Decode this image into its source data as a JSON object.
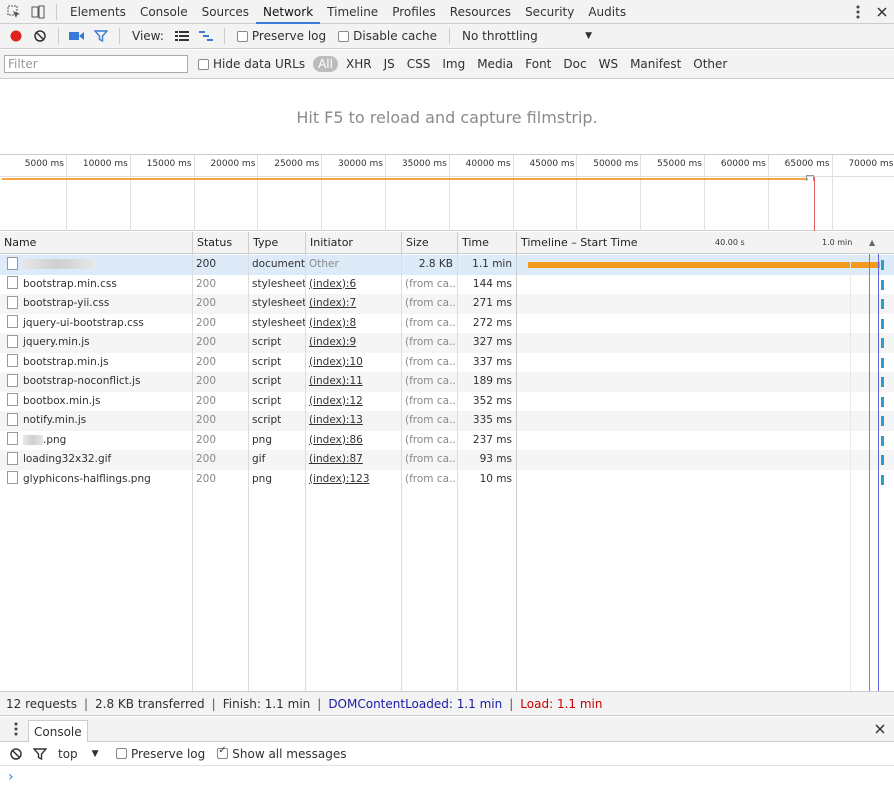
{
  "tabs": [
    "Elements",
    "Console",
    "Sources",
    "Network",
    "Timeline",
    "Profiles",
    "Resources",
    "Security",
    "Audits"
  ],
  "active_tab": "Network",
  "toolbar": {
    "view_label": "View:",
    "preserve_log": "Preserve log",
    "disable_cache": "Disable cache",
    "throttling": "No throttling"
  },
  "filterbar": {
    "placeholder": "Filter",
    "hide_data_urls": "Hide data URLs",
    "types": [
      "All",
      "XHR",
      "JS",
      "CSS",
      "Img",
      "Media",
      "Font",
      "Doc",
      "WS",
      "Manifest",
      "Other"
    ]
  },
  "filmstrip_message": "Hit F5 to reload and capture filmstrip.",
  "overview_ticks": [
    "5000 ms",
    "10000 ms",
    "15000 ms",
    "20000 ms",
    "25000 ms",
    "30000 ms",
    "35000 ms",
    "40000 ms",
    "45000 ms",
    "50000 ms",
    "55000 ms",
    "60000 ms",
    "65000 ms",
    "70000 ms"
  ],
  "columns": {
    "name": "Name",
    "status": "Status",
    "type": "Type",
    "initiator": "Initiator",
    "size": "Size",
    "time": "Time",
    "timeline": "Timeline – Start Time",
    "tick1": "40.00 s",
    "tick2": "1.0 min"
  },
  "rows": [
    {
      "name": "",
      "status": "200",
      "type": "document",
      "initiator": "Other",
      "size": "2.8 KB",
      "time": "1.1 min"
    },
    {
      "name": "bootstrap.min.css",
      "status": "200",
      "type": "stylesheet",
      "initiator": "(index):6",
      "size": "(from ca...",
      "time": "144 ms"
    },
    {
      "name": "bootstrap-yii.css",
      "status": "200",
      "type": "stylesheet",
      "initiator": "(index):7",
      "size": "(from ca...",
      "time": "271 ms"
    },
    {
      "name": "jquery-ui-bootstrap.css",
      "status": "200",
      "type": "stylesheet",
      "initiator": "(index):8",
      "size": "(from ca...",
      "time": "272 ms"
    },
    {
      "name": "jquery.min.js",
      "status": "200",
      "type": "script",
      "initiator": "(index):9",
      "size": "(from ca...",
      "time": "327 ms"
    },
    {
      "name": "bootstrap.min.js",
      "status": "200",
      "type": "script",
      "initiator": "(index):10",
      "size": "(from ca...",
      "time": "337 ms"
    },
    {
      "name": "bootstrap-noconflict.js",
      "status": "200",
      "type": "script",
      "initiator": "(index):11",
      "size": "(from ca...",
      "time": "189 ms"
    },
    {
      "name": "bootbox.min.js",
      "status": "200",
      "type": "script",
      "initiator": "(index):12",
      "size": "(from ca...",
      "time": "352 ms"
    },
    {
      "name": "notify.min.js",
      "status": "200",
      "type": "script",
      "initiator": "(index):13",
      "size": "(from ca...",
      "time": "335 ms"
    },
    {
      "name": ".png",
      "status": "200",
      "type": "png",
      "initiator": "(index):86",
      "size": "(from ca...",
      "time": "237 ms"
    },
    {
      "name": "loading32x32.gif",
      "status": "200",
      "type": "gif",
      "initiator": "(index):87",
      "size": "(from ca...",
      "time": "93 ms"
    },
    {
      "name": "glyphicons-halflings.png",
      "status": "200",
      "type": "png",
      "initiator": "(index):123",
      "size": "(from ca...",
      "time": "10 ms"
    }
  ],
  "status": {
    "requests": "12 requests",
    "transferred": "2.8 KB transferred",
    "finish": "Finish: 1.1 min",
    "dom": "DOMContentLoaded: 1.1 min",
    "load": "Load: 1.1 min"
  },
  "drawer": {
    "tab": "Console",
    "context": "top",
    "preserve_log": "Preserve log",
    "show_all": "Show all messages",
    "prompt": "›"
  },
  "colors": {
    "document_bar": "#f29a1d",
    "resource_bar": "#2a9ed4",
    "accent": "#3879d9",
    "record": "#e0221f"
  }
}
